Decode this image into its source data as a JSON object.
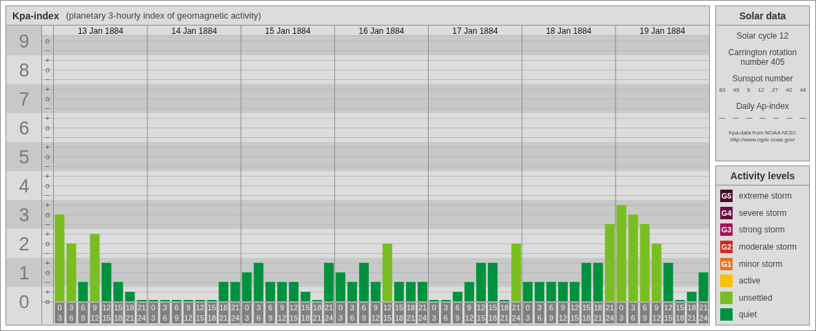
{
  "kpa_panel": {
    "title": "Kpa-index",
    "subtitle": "(planetary 3-hourly index of geomagnetic activity)",
    "days": [
      "13 Jan 1884",
      "14 Jan 1884",
      "15 Jan 1884",
      "16 Jan 1884",
      "17 Jan 1884",
      "18 Jan 1884",
      "19 Jan 1884"
    ],
    "minor_ytick_labels": [
      "o",
      "−",
      "+",
      "o",
      "−",
      "+",
      "o",
      "−",
      "+",
      "o",
      "−",
      "+",
      "o",
      "−",
      "+",
      "o",
      "−",
      "+",
      "o",
      "−",
      "+",
      "o",
      "−",
      "+",
      "o",
      "−",
      "+",
      "o"
    ],
    "chart_data": {
      "type": "bar",
      "stacked": true,
      "grid": true,
      "ylim": [
        0,
        9
      ],
      "yticks": [
        {
          "value": 0,
          "label": "0"
        },
        {
          "value": 1,
          "label": "1"
        },
        {
          "value": 2,
          "label": "2"
        },
        {
          "value": 3,
          "label": "3"
        },
        {
          "value": 4,
          "label": "4"
        },
        {
          "value": 5,
          "label": "5"
        },
        {
          "value": 6,
          "label": "6"
        },
        {
          "value": 7,
          "label": "7"
        },
        {
          "value": 8,
          "label": "8"
        },
        {
          "value": 9,
          "label": "9"
        }
      ],
      "categories": [
        "0 3",
        "3 6",
        "6 9",
        "9 12",
        "12 15",
        "15 18",
        "18 21",
        "21 24",
        "0 3",
        "3 6",
        "6 9",
        "9 12",
        "12 15",
        "15 18",
        "18 21",
        "21 24",
        "0 3",
        "3 6",
        "6 9",
        "9 12",
        "12 15",
        "15 18",
        "18 21",
        "21 24",
        "0 3",
        "3 6",
        "6 9",
        "9 12",
        "12 15",
        "15 18",
        "18 21",
        "21 24",
        "0 3",
        "3 6",
        "6 9",
        "9 12",
        "12 15",
        "15 18",
        "18 21",
        "21 24",
        "0 3",
        "3 6",
        "6 9",
        "9 12",
        "12 15",
        "15 18",
        "18 21",
        "21 24",
        "0 3",
        "3 6",
        "6 9",
        "9 12",
        "12 15",
        "15 18",
        "18 21",
        "21 24"
      ],
      "series": [
        {
          "color": "#00913f",
          "values": [
            null,
            null,
            0.67,
            null,
            1.33,
            0.67,
            0.33,
            0,
            0,
            0,
            0,
            0,
            0,
            0,
            0.67,
            0.67,
            1,
            1.33,
            0.67,
            0.67,
            0.67,
            0.33,
            0,
            1.33,
            1,
            0.67,
            1.33,
            0.67,
            null,
            0.67,
            0.67,
            0.67,
            0,
            0,
            0.33,
            0.67,
            1.33,
            1.33,
            0,
            null,
            0.67,
            0.67,
            0.67,
            0.67,
            0.67,
            1.33,
            1.33,
            null,
            null,
            null,
            null,
            null,
            1.33,
            0,
            0.33,
            1
          ]
        },
        {
          "color": "#79be21",
          "values": [
            3,
            2,
            null,
            2.33,
            null,
            null,
            null,
            null,
            null,
            null,
            null,
            null,
            null,
            null,
            null,
            null,
            null,
            null,
            null,
            null,
            null,
            null,
            null,
            null,
            null,
            null,
            null,
            null,
            2,
            null,
            null,
            null,
            null,
            null,
            null,
            null,
            null,
            null,
            null,
            2,
            null,
            null,
            null,
            null,
            null,
            null,
            null,
            2.67,
            3.33,
            3,
            2.67,
            2,
            null,
            null,
            null,
            null
          ]
        }
      ]
    }
  },
  "solar_data": {
    "title": "Solar data",
    "solar_cycle": "Solar cycle 12",
    "carrington": "Carrington rotation number 405",
    "sunspot_heading": "Sunspot number",
    "sunspot_numbers": [
      "83",
      "45",
      "5",
      "12",
      "27",
      "42",
      "48"
    ],
    "ap_heading": "Daily Ap-index",
    "ap_values": [
      "—",
      "—",
      "—",
      "—",
      "—",
      "—",
      "—"
    ],
    "source": "Kpa-data from NOAA NCEI:",
    "source_url": "http://www.ngdc.noaa.gov/"
  },
  "activity_levels": {
    "title": "Activity levels",
    "items": [
      {
        "badge": "G5",
        "label": "extreme storm",
        "color": "#4b0a2a"
      },
      {
        "badge": "G4",
        "label": "severe storm",
        "color": "#6e0a3e"
      },
      {
        "badge": "G3",
        "label": "strong storm",
        "color": "#a80f5c"
      },
      {
        "badge": "G2",
        "label": "moderate storm",
        "color": "#d8281c"
      },
      {
        "badge": "G1",
        "label": "minor storm",
        "color": "#e8731c"
      },
      {
        "label": "active",
        "color": "#fcc200"
      },
      {
        "label": "unsettled",
        "color": "#79be21"
      },
      {
        "label": "quiet",
        "color": "#00913f"
      }
    ]
  }
}
